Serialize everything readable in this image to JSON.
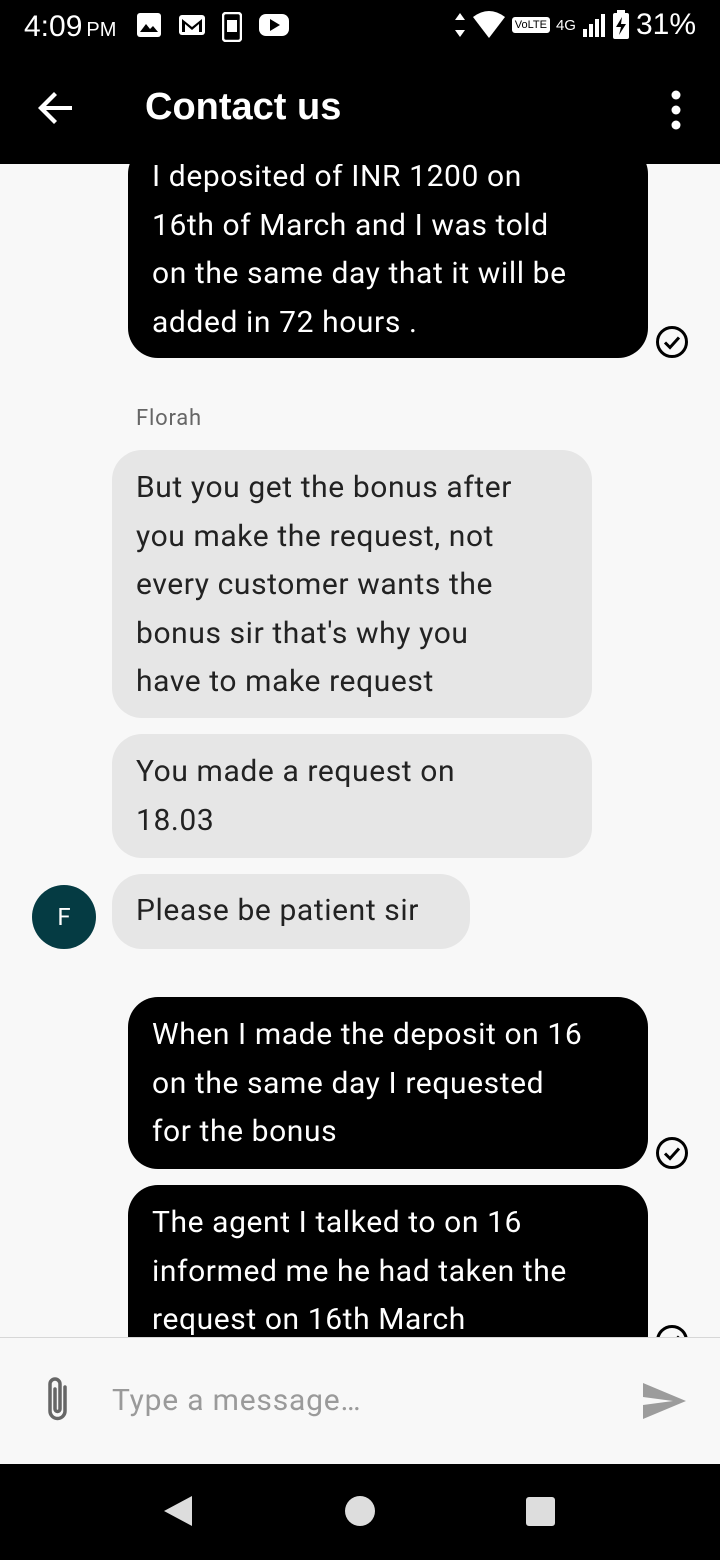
{
  "status_bar": {
    "time": "4:09",
    "ampm": "PM",
    "network_badge": "VoLTE",
    "network_type": "4G",
    "battery": "31%"
  },
  "app_bar": {
    "title": "Contact us"
  },
  "messages": [
    {
      "direction": "outgoing",
      "lines": [
        "I deposited of INR 1200 on",
        "16th of March and I was told",
        "on the same day that it will be",
        "added in 72 hours ."
      ]
    },
    {
      "direction": "incoming",
      "sender": "Florah",
      "lines": [
        "But you get the bonus after",
        "you make the request, not",
        "every customer wants the",
        "bonus sir that's why you",
        "have to make request"
      ]
    },
    {
      "direction": "incoming",
      "lines": [
        "You made a request on",
        "18.03"
      ]
    },
    {
      "direction": "incoming",
      "avatar_letter": "F",
      "lines": [
        "Please be patient sir"
      ]
    },
    {
      "direction": "outgoing",
      "lines": [
        "When I made the deposit on 16",
        "on the same day I requested",
        "for the bonus"
      ]
    },
    {
      "direction": "outgoing",
      "lines": [
        "The agent I talked to on 16",
        "informed me he had taken the",
        "request on 16th March"
      ]
    }
  ],
  "composer": {
    "placeholder": "Type a message…"
  },
  "colors": {
    "outgoing_bubble": "#000000",
    "incoming_bubble": "#e6e6e6",
    "avatar": "#053b43",
    "chat_background": "#f8f8f8"
  },
  "icons": {
    "back": "arrow-left-icon",
    "more": "more-vert-icon",
    "read_receipt": "check-circle-icon",
    "attach": "paperclip-icon",
    "send": "send-icon"
  }
}
